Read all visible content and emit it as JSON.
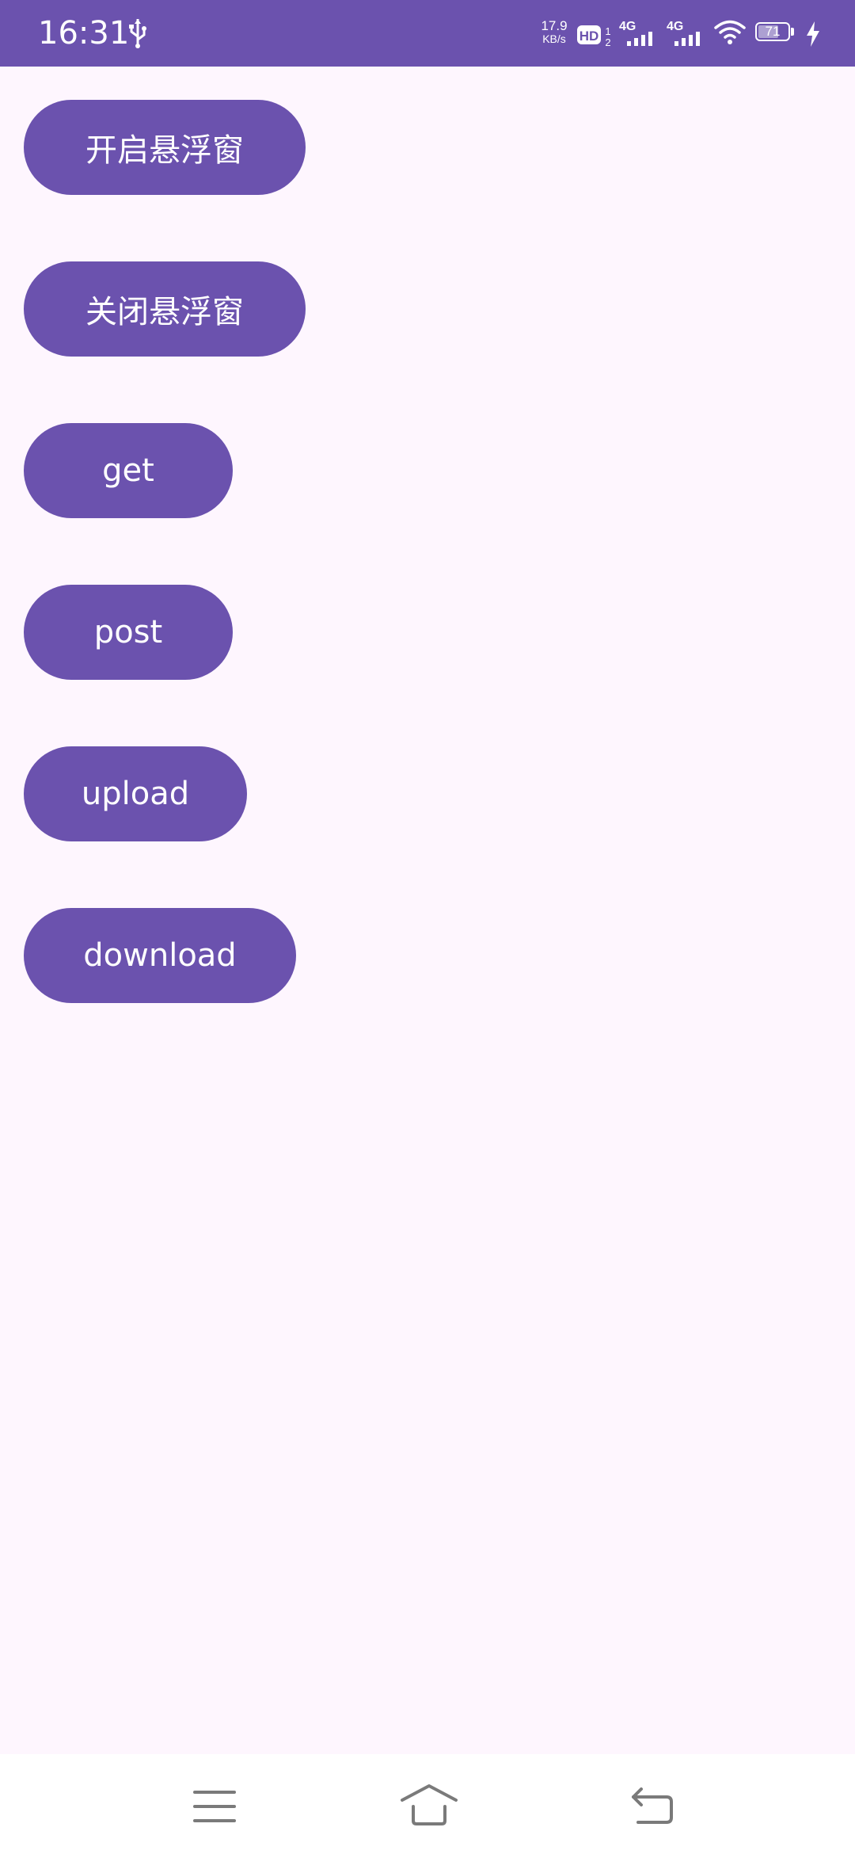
{
  "status_bar": {
    "time": "16:31",
    "net_speed_value": "17.9",
    "net_speed_unit": "KB/s",
    "hd_label": "HD",
    "sim1_label": "4G",
    "sim2_label": "4G",
    "battery_level": "71",
    "background_color": "#6B52AE",
    "icons": [
      "usb-icon",
      "hd-icon",
      "signal-icon",
      "signal-icon",
      "wifi-icon",
      "battery-icon",
      "charging-icon"
    ]
  },
  "main": {
    "button_color": "#6B52AE",
    "background_color": "#FEF6FE",
    "buttons": [
      {
        "label": "开启悬浮窗"
      },
      {
        "label": "关闭悬浮窗"
      },
      {
        "label": "get"
      },
      {
        "label": "post"
      },
      {
        "label": "upload"
      },
      {
        "label": "download"
      }
    ]
  },
  "nav_bar": {
    "icons": [
      "menu-icon",
      "home-icon",
      "back-icon"
    ]
  }
}
